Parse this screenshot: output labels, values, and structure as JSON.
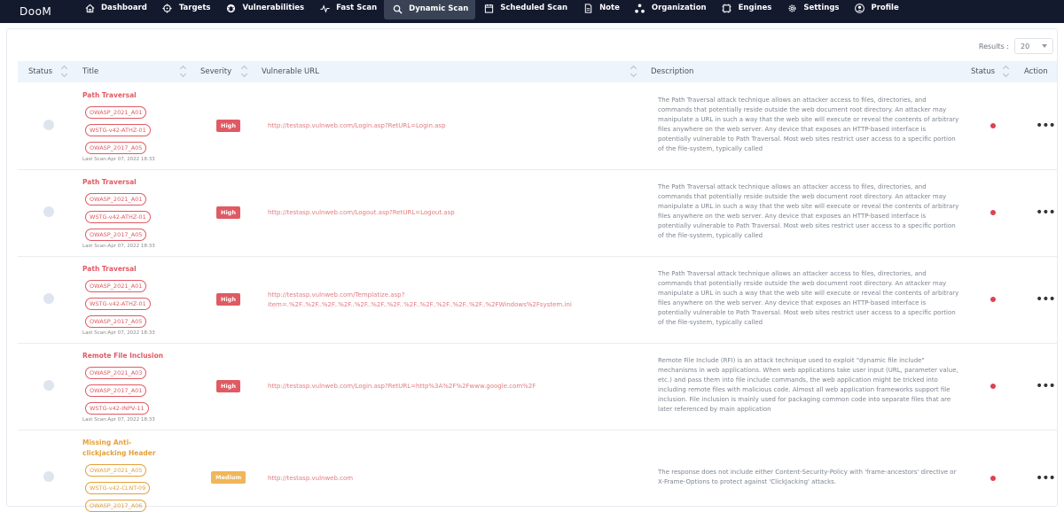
{
  "brand": "DooM",
  "nav": [
    {
      "label": "Dashboard",
      "icon": "home-icon"
    },
    {
      "label": "Targets",
      "icon": "crosshair-icon"
    },
    {
      "label": "Vulnerabilities",
      "icon": "bug-icon"
    },
    {
      "label": "Fast Scan",
      "icon": "pulse-icon"
    },
    {
      "label": "Dynamic Scan",
      "icon": "search-icon",
      "active": true
    },
    {
      "label": "Scheduled Scan",
      "icon": "calendar-icon"
    },
    {
      "label": "Note",
      "icon": "note-icon"
    },
    {
      "label": "Organization",
      "icon": "organization-icon"
    },
    {
      "label": "Engines",
      "icon": "engine-icon"
    },
    {
      "label": "Settings",
      "icon": "gear-icon"
    },
    {
      "label": "Profile",
      "icon": "user-icon"
    }
  ],
  "results": {
    "label": "Results :",
    "value": "20"
  },
  "table": {
    "headers": {
      "status": "Status",
      "title": "Title",
      "severity": "Severity",
      "url": "Vulnerable URL",
      "description": "Description",
      "status2": "Status",
      "action": "Action"
    },
    "rows": [
      {
        "title": "Path Traversal",
        "tags": [
          "OWASP_2021_A01",
          "WSTG-v42-ATHZ-01",
          "OWASP_2017_A05"
        ],
        "last_scan": "Last Scan:Apr 07, 2022 18:33",
        "severity": "High",
        "url": "http://testasp.vulnweb.com/Login.asp?RetURL=Login.asp",
        "description": "The Path Traversal attack technique allows an attacker access to files, directories, and commands that potentially reside outside the web document root directory. An attacker may manipulate a URL in such a way that the web site will execute or reveal the contents of arbitrary files anywhere on the web server. Any device that exposes an HTTP-based interface is potentially vulnerable to Path Traversal. Most web sites restrict user access to a specific portion of the file-system, typically called",
        "action": "•••"
      },
      {
        "title": "Path Traversal",
        "tags": [
          "OWASP_2021_A01",
          "WSTG-v42-ATHZ-01",
          "OWASP_2017_A05"
        ],
        "last_scan": "Last Scan:Apr 07, 2022 18:33",
        "severity": "High",
        "url": "http://testasp.vulnweb.com/Logout.asp?RetURL=Logout.asp",
        "description": "The Path Traversal attack technique allows an attacker access to files, directories, and commands that potentially reside outside the web document root directory. An attacker may manipulate a URL in such a way that the web site will execute or reveal the contents of arbitrary files anywhere on the web server. Any device that exposes an HTTP-based interface is potentially vulnerable to Path Traversal. Most web sites restrict user access to a specific portion of the file-system, typically called",
        "action": "•••"
      },
      {
        "title": "Path Traversal",
        "tags": [
          "OWASP_2021_A01",
          "WSTG-v42-ATHZ-01",
          "OWASP_2017_A05"
        ],
        "last_scan": "Last Scan:Apr 07, 2022 18:33",
        "severity": "High",
        "url": "http://testasp.vulnweb.com/Templatize.asp?item=.%2F..%2F..%2F..%2F..%2F..%2F..%2F..%2F..%2F..%2F..%2F..%2F..%2FWindows%2Fsystem.ini",
        "description": "The Path Traversal attack technique allows an attacker access to files, directories, and commands that potentially reside outside the web document root directory. An attacker may manipulate a URL in such a way that the web site will execute or reveal the contents of arbitrary files anywhere on the web server. Any device that exposes an HTTP-based interface is potentially vulnerable to Path Traversal. Most web sites restrict user access to a specific portion of the file-system, typically called",
        "action": "•••"
      },
      {
        "title": "Remote File Inclusion",
        "tags": [
          "OWASP_2021_A03",
          "OWASP_2017_A01",
          "WSTG-v42-INPV-11"
        ],
        "last_scan": "Last Scan:Apr 07, 2022 18:33",
        "severity": "High",
        "url": "http://testasp.vulnweb.com/Login.asp?RetURL=http%3A%2F%2Fwww.google.com%2F",
        "description": "Remote File Include (RFI) is an attack technique used to exploit \"dynamic file include\" mechanisms in web applications. When web applications take user input (URL, parameter value, etc.) and pass them into file include commands, the web application might be tricked into including remote files with malicious code. Almost all web application frameworks support file inclusion. File inclusion is mainly used for packaging common code into separate files that are later referenced by main application",
        "action": "•••"
      },
      {
        "title": "Missing Anti-clickjacking Header",
        "tags": [
          "OWASP_2021_A05",
          "WSTG-v42-CLNT-09",
          "OWASP_2017_A06"
        ],
        "last_scan": "",
        "severity": "Medium",
        "url": "http://testasp.vulnweb.com",
        "description": "The response does not include either Content-Security-Policy with 'frame-ancestors' directive or X-Frame-Options to protect against 'ClickJacking' attacks.",
        "action": "•••"
      }
    ]
  }
}
